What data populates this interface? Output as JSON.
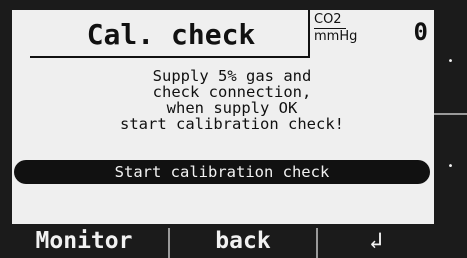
{
  "header": {
    "title": "Cal. check",
    "unit_top": "CO2",
    "unit_bottom": "mmHg",
    "value": "0"
  },
  "message": {
    "lines": [
      "Supply 5% gas and",
      "check connection,",
      "when supply OK",
      "start calibration check!"
    ]
  },
  "start_button": {
    "label": "Start calibration check"
  },
  "side_keys": {
    "upper": "•",
    "lower": "•"
  },
  "softkeys": {
    "monitor": "Monitor",
    "back": "back",
    "enter": "↲"
  }
}
